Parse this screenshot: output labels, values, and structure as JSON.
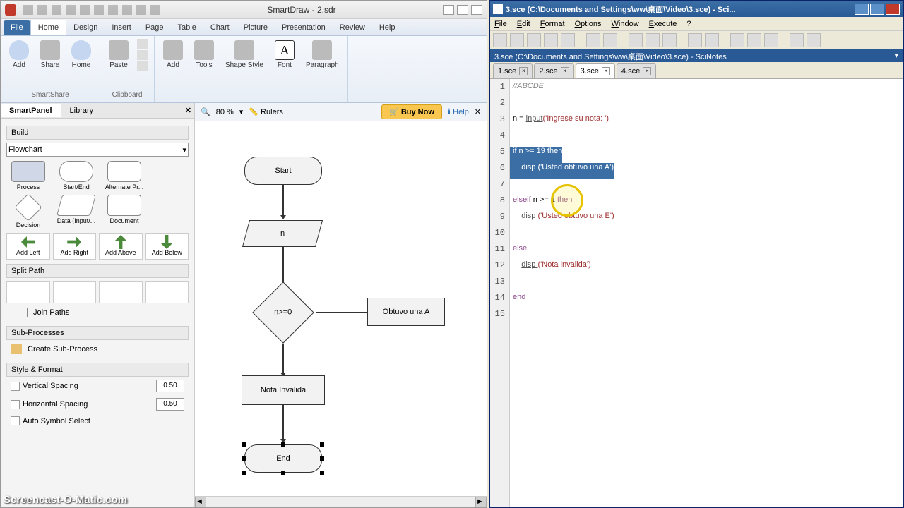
{
  "smartdraw": {
    "title": "SmartDraw - 2.sdr",
    "tabs": [
      "File",
      "Home",
      "Design",
      "Insert",
      "Page",
      "Table",
      "Chart",
      "Picture",
      "Presentation",
      "Review",
      "Help"
    ],
    "ribbon": {
      "smartshare": {
        "add": "Add",
        "home": "Home",
        "share": "Share",
        "title": "SmartShare"
      },
      "clipboard": {
        "paste": "Paste",
        "title": "Clipboard"
      },
      "items": {
        "addshape": "Add",
        "tools": "Tools",
        "shapestyle": "Shape\nStyle",
        "font": "Font",
        "paragraph": "Paragraph"
      }
    },
    "toolbar": {
      "zoom": "80 %",
      "rulers": "Rulers",
      "buy": "Buy Now",
      "help": "Help"
    },
    "panel": {
      "tabs": [
        "SmartPanel",
        "Library"
      ],
      "build": "Build",
      "shapetype": "Flowchart",
      "shapes": [
        "Process",
        "Start/End",
        "Alternate Pr...",
        "Decision",
        "Data (Input/...",
        "Document"
      ],
      "arrows": [
        "Add Left",
        "Add Right",
        "Add Above",
        "Add Below"
      ],
      "splitpath": "Split Path",
      "joinpaths": "Join Paths",
      "subproc": "Sub-Processes",
      "createsub": "Create Sub-Process",
      "style": "Style & Format",
      "vspacing": "Vertical Spacing",
      "hspacing": "Horizontal Spacing",
      "autosym": "Auto Symbol Select",
      "vsval": "0.50",
      "hsval": "0.50"
    },
    "flowchart": {
      "start": "Start",
      "input": "n",
      "decision": "n>=0",
      "procA": "Obtuvo una A",
      "procInvalid": "Nota Invalida",
      "end": "End"
    }
  },
  "scinotes": {
    "title": "3.sce (C:\\Documents and Settings\\ww\\桌面\\Video\\3.sce) - Sci...",
    "menu": [
      "File",
      "Edit",
      "Format",
      "Options",
      "Window",
      "Execute",
      "?"
    ],
    "path": "3.sce (C:\\Documents and Settings\\ww\\桌面\\Video\\3.sce) - SciNotes",
    "tabs": [
      "1.sce",
      "2.sce",
      "3.sce",
      "4.sce"
    ],
    "code": {
      "l1_comment": "//ABCDE",
      "l3_var": "n = ",
      "l3_fn": "input",
      "l3_str": "('Ingrese su nota: ')",
      "l5": "if n >= 19 then",
      "l6_indent": "    ",
      "l6_fn": "disp ",
      "l6_str": "('Usted obtuvo una A')",
      "l8a": "els",
      "l8b": "eif",
      "l8c": " n >= 1 ",
      "l8d": "then",
      "l9_indent": "    ",
      "l9_fn": "disp ",
      "l9_str": "('Usted obtuvo una E')",
      "l11": "else",
      "l12_indent": "    ",
      "l12_fn": "disp ",
      "l12_str": "('Nota invalida')",
      "l14": "end"
    }
  },
  "watermark": "Screencast-O-Matic.com"
}
